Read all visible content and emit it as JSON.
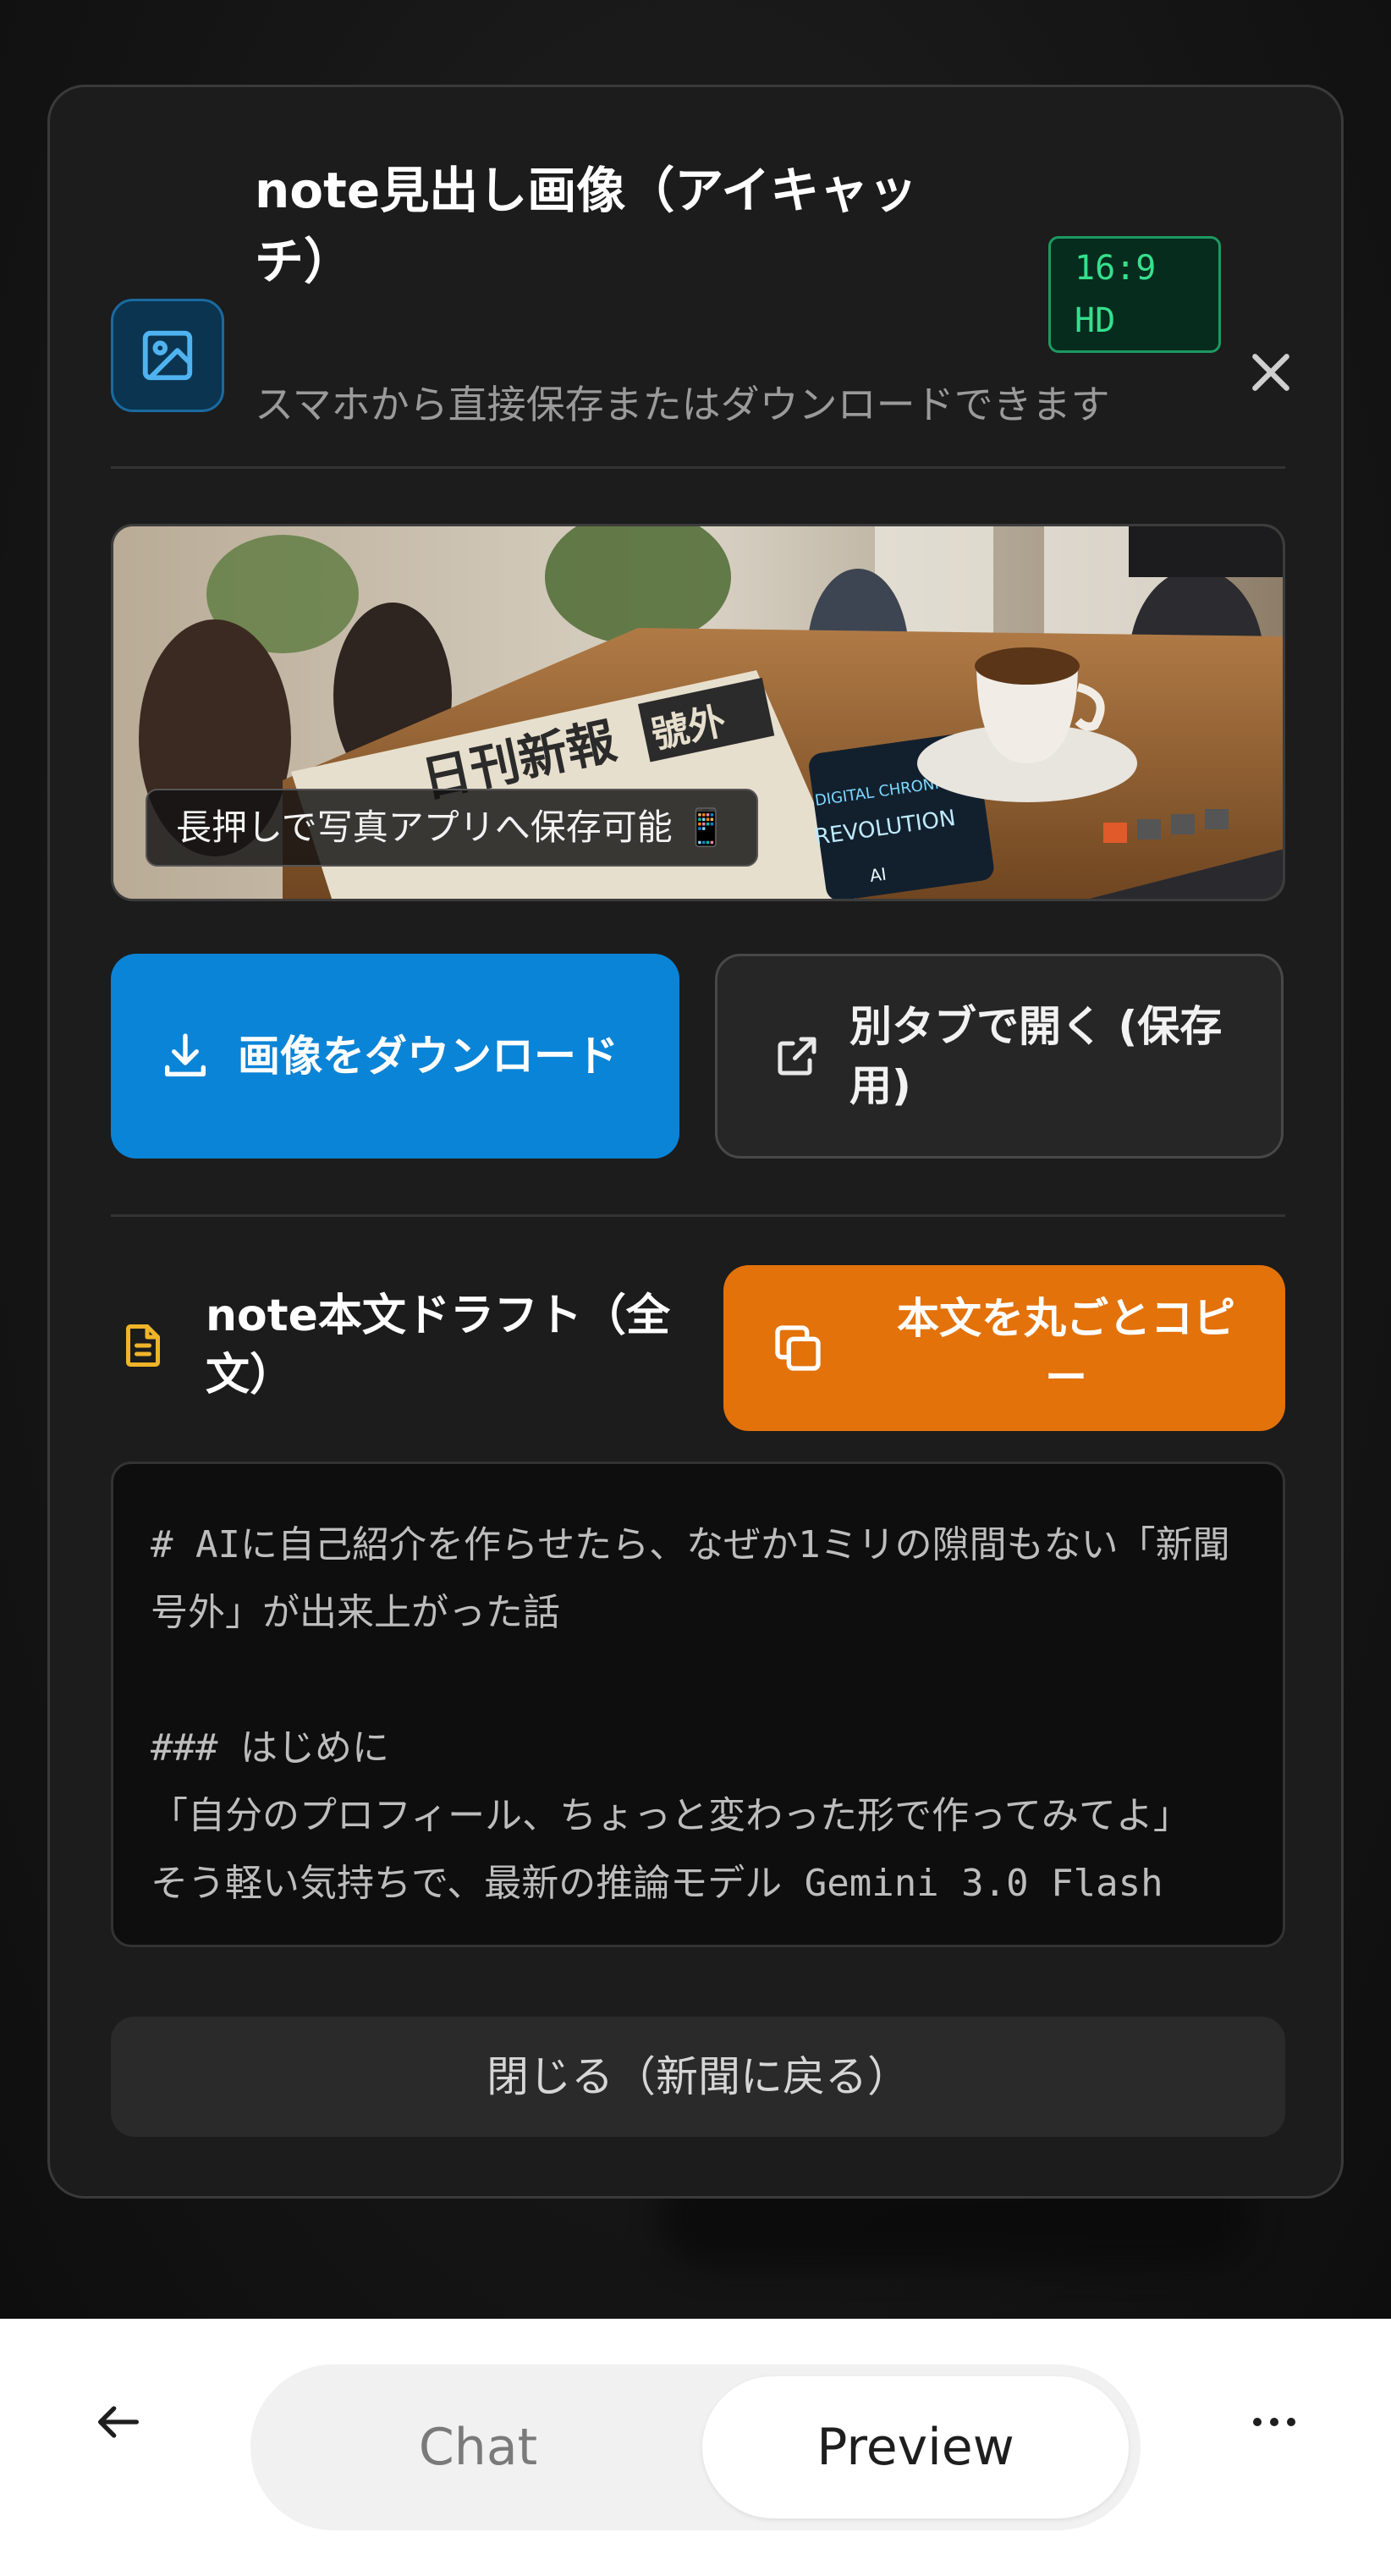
{
  "modal": {
    "title": "note見出し画像（アイキャッチ）",
    "badge_line1": "16:9",
    "badge_line2": "HD",
    "subtitle": "スマホから直接保存またはダウンロードできます",
    "image_hint": "長押しで写真アプリへ保存可能 📱",
    "image_texts": [
      "日刊新報",
      "號外",
      "DIGITAL CHRONICLE",
      "REVOLUTION",
      "AI"
    ],
    "download_label": "画像をダウンロード",
    "open_tab_label": "別タブで開く (保存用)",
    "draft_title": "note本文ドラフト（全文）",
    "copy_label": "本文を丸ごとコピー",
    "draft_text": "# AIに自己紹介を作らせたら、なぜか1ミリの隙間もない「新聞号外」が出来上がった話\n\n### はじめに\n「自分のプロフィール、ちょっと変わった形で作ってみてよ」\nそう軽い気持ちで、最新の推論モデル Gemini 3.0 Flash",
    "close_label": "閉じる（新聞に戻る）"
  },
  "bottom_bar": {
    "tabs": [
      {
        "label": "Chat",
        "active": false
      },
      {
        "label": "Preview",
        "active": true
      }
    ]
  },
  "colors": {
    "download": "#0a84d6",
    "copy": "#e3720a",
    "badge": "#35e08c"
  },
  "icons": [
    "image-icon",
    "close-icon",
    "download-icon",
    "external-link-icon",
    "document-icon",
    "copy-icon",
    "arrow-left-icon",
    "more-icon"
  ]
}
